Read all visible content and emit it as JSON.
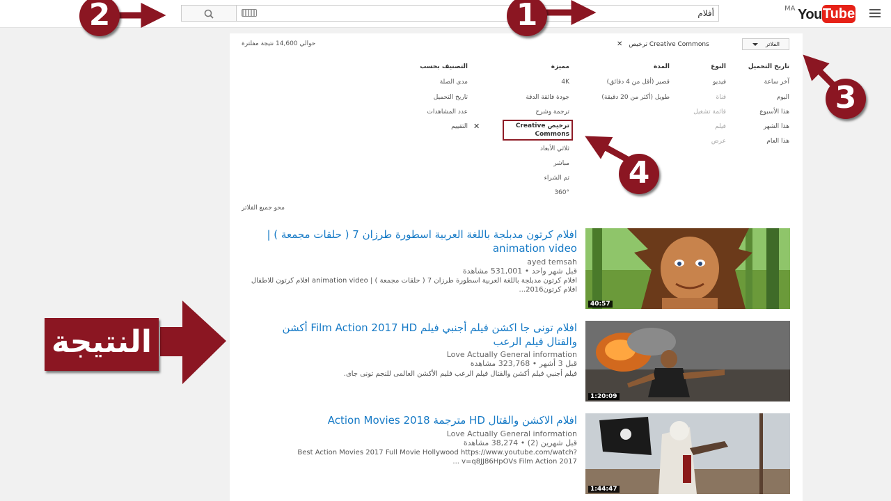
{
  "header": {
    "logo_prefix": "MA",
    "logo_you": "You",
    "logo_tube": "Tube",
    "search_query": "أفلام"
  },
  "filters": {
    "button_label": "الفلاتر",
    "active_chip": "ترخيص Creative Commons",
    "result_count": "حوالي 14,600 نتيجة مفلترة",
    "clear_all": "محو جميع الفلاتر",
    "columns": [
      {
        "header": "تاريخ التحميل",
        "options": [
          {
            "label": "آخر ساعة",
            "dim": false
          },
          {
            "label": "اليوم",
            "dim": false
          },
          {
            "label": "هذا الأسبوع",
            "dim": false
          },
          {
            "label": "هذا الشهر",
            "dim": false
          },
          {
            "label": "هذا العام",
            "dim": false
          }
        ]
      },
      {
        "header": "النوع",
        "options": [
          {
            "label": "فيديو",
            "dim": false
          },
          {
            "label": "قناة",
            "dim": true
          },
          {
            "label": "قائمة تشغيل",
            "dim": true
          },
          {
            "label": "فيلم",
            "dim": true
          },
          {
            "label": "عرض",
            "dim": true
          }
        ]
      },
      {
        "header": "المدة",
        "options": [
          {
            "label": "قصير (أقل من 4 دقائق)",
            "dim": false
          },
          {
            "label": "طويل (أكثر من 20 دقيقة)",
            "dim": false
          }
        ]
      },
      {
        "header": "مميزة",
        "options": [
          {
            "label": "4K",
            "dim": false
          },
          {
            "label": "جودة فائقة الدقة",
            "dim": false
          },
          {
            "label": "ترجمة وشرح",
            "dim": false
          },
          {
            "label": "ترخيص Creative Commons",
            "dim": false
          },
          {
            "label": "ثلاثي الأبعاد",
            "dim": false
          },
          {
            "label": "مباشر",
            "dim": false
          },
          {
            "label": "تم الشراء",
            "dim": false
          },
          {
            "label": "360°",
            "dim": false
          }
        ]
      },
      {
        "header": "التصنيف بحسب",
        "options": [
          {
            "label": "مدى الصلة",
            "dim": false
          },
          {
            "label": "تاريخ التحميل",
            "dim": false
          },
          {
            "label": "عدد المشاهدات",
            "dim": false
          },
          {
            "label": "التقييم",
            "dim": false
          }
        ]
      }
    ]
  },
  "results": [
    {
      "title": "افلام كرتون مدبلجة باللغة العربية اسطورة طرزان 7 ( حلقات مجمعة ) | animation video",
      "channel": "ayed temsah",
      "meta": "قبل شهر واحد • 531,001 مشاهدة",
      "description": "افلام كرتون مدبلجة باللغة العربية اسطورة طرزان 7 ( حلقات مجمعة ) | animation video افلام كرتون للاطفال افلام كرتون2016...",
      "duration": "40:57"
    },
    {
      "title": "افلام تونى جا اكشن فيلم أجنبي فيلم Film Action 2017 HD أكشن والقتال فيلم الرعب",
      "channel": "Love Actually General information",
      "meta": "قبل 3 أشهر • 323,768 مشاهدة",
      "description": "فيلم أجنبي فيلم أكشن والقتال فيلم الرعب فليم الأكشن العالمى للنجم تونى جاى.",
      "duration": "1:20:09"
    },
    {
      "title": "افلام الاكشن والقتال HD مترجمة Action Movies 2018",
      "channel": "Love Actually General information",
      "meta": "قبل شهرين (2) • 38,274 مشاهدة",
      "description": "Best Action Movies 2017 Full Movie Hollywood https://www.youtube.com/watch?v=q8JJ86HpOVs Film Action 2017 ...",
      "duration": "1:44:47"
    }
  ],
  "annotations": {
    "badge_1": "1",
    "badge_2": "2",
    "badge_3": "3",
    "badge_4": "4",
    "result_label": "النتيجة"
  },
  "colors": {
    "annotation_red": "#8b1622",
    "badge_digit": "#ffffff",
    "link_blue": "#167ac6",
    "youtube_red": "#e62117"
  }
}
